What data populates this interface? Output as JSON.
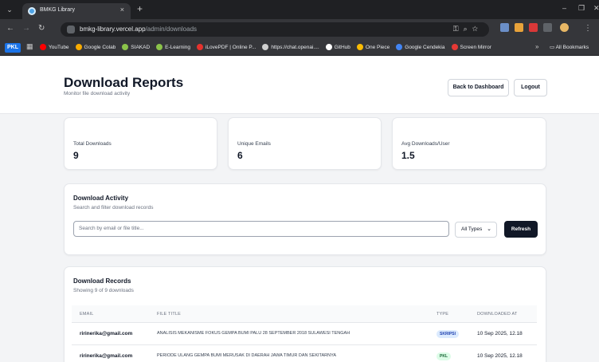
{
  "browser": {
    "tab_title": "BMKG Library",
    "tab_close": "×",
    "new_tab": "+",
    "url_host": "bmkg-library.vercel.app",
    "url_path": "/admin/downloads",
    "bookmarks": [
      {
        "label": "YouTube",
        "color": "#ff0000"
      },
      {
        "label": "Google Colab",
        "color": "#f9ab00"
      },
      {
        "label": "SIAKAD",
        "color": "#8bc34a"
      },
      {
        "label": "E-Learning",
        "color": "#8bc34a"
      },
      {
        "label": "iLovePDF | Online P...",
        "color": "#e5322d"
      },
      {
        "label": "https://chat.openai....",
        "color": "#cfcfcf"
      },
      {
        "label": "GitHub",
        "color": "#ffffff"
      },
      {
        "label": "One Piece",
        "color": "#fbbc04"
      },
      {
        "label": "Google Cendekia",
        "color": "#4285f4"
      },
      {
        "label": "Screen Mirror",
        "color": "#e53935"
      }
    ],
    "bookmarks_more": "»",
    "all_bookmarks": "All Bookmarks",
    "profile_badge": "PKL"
  },
  "header": {
    "title": "Download Reports",
    "subtitle": "Monitor file download activity",
    "back_label": "Back to Dashboard",
    "logout_label": "Logout"
  },
  "stats": [
    {
      "label": "Total Downloads",
      "value": "9"
    },
    {
      "label": "Unique Emails",
      "value": "6"
    },
    {
      "label": "Avg Downloads/User",
      "value": "1.5"
    }
  ],
  "activity": {
    "title": "Download Activity",
    "subtitle": "Search and filter download records",
    "search_placeholder": "Search by email or file title...",
    "type_selected": "All Types",
    "refresh_label": "Refresh"
  },
  "records": {
    "title": "Download Records",
    "subtitle": "Showing 9 of 9 downloads",
    "columns": [
      "EMAIL",
      "FILE TITLE",
      "TYPE",
      "DOWNLOADED AT"
    ],
    "rows": [
      {
        "email": "ririnerika@gmail.com",
        "title": "ANALISIS MEKANISME FOKUS GEMPA BUMI PALU 28 SEPTEMBER 2018 SULAWESI TENGAH",
        "type": "SKRIPSI",
        "type_bg": "#dbeafe",
        "type_fg": "#1e40af",
        "date": "10 Sep 2025, 12.18"
      },
      {
        "email": "ririnerika@gmail.com",
        "title": "PERIODE ULANG GEMPA BUMI MERUSAK DI DAERAH JAWA TIMUR DAN SEKITARNYA",
        "type": "PKL",
        "type_bg": "#dcfce7",
        "type_fg": "#166534",
        "date": "10 Sep 2025, 12.18"
      }
    ]
  }
}
